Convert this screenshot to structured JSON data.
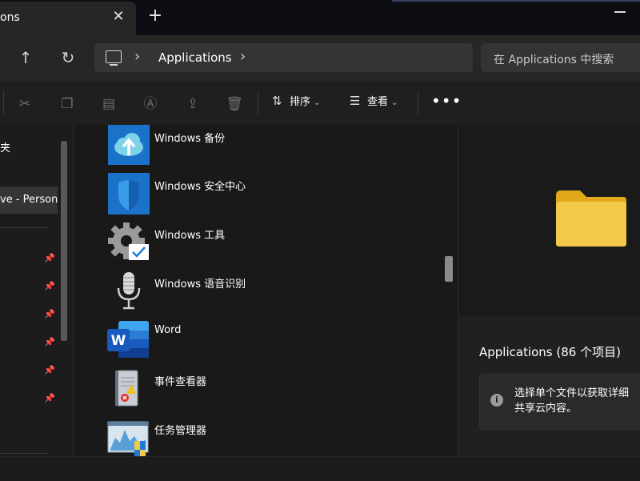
{
  "tab": {
    "label": "ons",
    "close": "✕",
    "new": "+"
  },
  "nav": {
    "up": "↑",
    "refresh": "↻"
  },
  "address": {
    "separator": "›",
    "path": "Applications"
  },
  "search": {
    "placeholder": "在 Applications 中搜索"
  },
  "toolbar": {
    "sort_label": "排序",
    "view_label": "查看",
    "more": "•••"
  },
  "sidebar": {
    "items": [
      {
        "label": "夹"
      },
      {
        "label": "ve - Person"
      }
    ]
  },
  "files": [
    {
      "name": "Windows 备份",
      "icon": "cloud-upload-icon"
    },
    {
      "name": "Windows 安全中心",
      "icon": "shield-icon"
    },
    {
      "name": "Windows 工具",
      "icon": "gear-icon"
    },
    {
      "name": "Windows 语音识别",
      "icon": "microphone-icon"
    },
    {
      "name": "Word",
      "icon": "word-icon"
    },
    {
      "name": "事件查看器",
      "icon": "event-viewer-icon"
    },
    {
      "name": "任务管理器",
      "icon": "task-manager-icon"
    }
  ],
  "preview": {
    "title": "Applications (86 个项目)",
    "info_line1": "选择单个文件以获取详细",
    "info_line2": "共享云内容。",
    "info_icon": "i"
  },
  "colors": {
    "folder": "#f3c94a",
    "accent_blue": "#1e7bd6"
  }
}
